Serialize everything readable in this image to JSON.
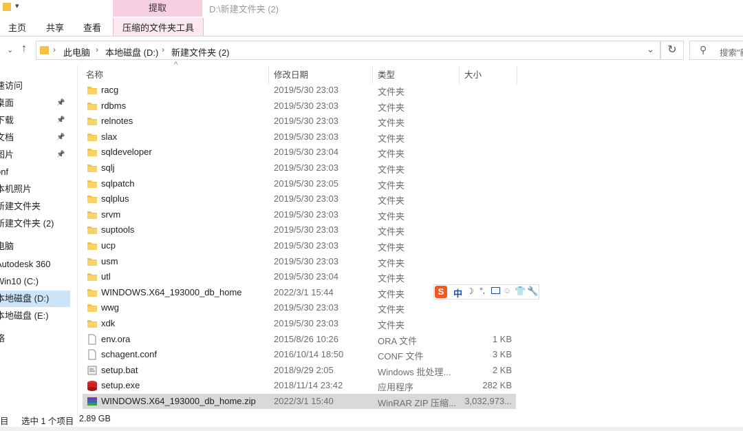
{
  "window": {
    "title": "D:\\新建文件夹 (2)",
    "context_tab": "提取"
  },
  "ribbon": {
    "tabs": [
      "主页",
      "共享",
      "查看"
    ],
    "context_subtab": "压缩的文件夹工具"
  },
  "address": {
    "crumbs": [
      "此电脑",
      "本地磁盘 (D:)",
      "新建文件夹 (2)"
    ],
    "search_placeholder": "搜索\"新"
  },
  "sidebar": {
    "items": [
      {
        "label": "速访问",
        "pinned": false,
        "selected": false
      },
      {
        "label": "桌面",
        "pinned": true,
        "selected": false
      },
      {
        "label": "下载",
        "pinned": true,
        "selected": false
      },
      {
        "label": "文档",
        "pinned": true,
        "selected": false
      },
      {
        "label": "图片",
        "pinned": true,
        "selected": false
      },
      {
        "label": "onf",
        "pinned": false,
        "selected": false
      },
      {
        "label": "本机照片",
        "pinned": false,
        "selected": false
      },
      {
        "label": "新建文件夹",
        "pinned": false,
        "selected": false
      },
      {
        "label": "新建文件夹 (2)",
        "pinned": false,
        "selected": false
      },
      {
        "label": "电脑",
        "pinned": false,
        "selected": false
      },
      {
        "label": "Autodesk 360",
        "pinned": false,
        "selected": false
      },
      {
        "label": "Win10 (C:)",
        "pinned": false,
        "selected": false
      },
      {
        "label": "本地磁盘 (D:)",
        "pinned": false,
        "selected": true
      },
      {
        "label": "本地磁盘 (E:)",
        "pinned": false,
        "selected": false
      },
      {
        "label": "络",
        "pinned": false,
        "selected": false
      }
    ]
  },
  "columns": {
    "name": "名称",
    "date": "修改日期",
    "type": "类型",
    "size": "大小"
  },
  "files": [
    {
      "name": "racg",
      "date": "2019/5/30 23:03",
      "type": "文件夹",
      "size": "",
      "icon": "folder"
    },
    {
      "name": "rdbms",
      "date": "2019/5/30 23:03",
      "type": "文件夹",
      "size": "",
      "icon": "folder"
    },
    {
      "name": "relnotes",
      "date": "2019/5/30 23:03",
      "type": "文件夹",
      "size": "",
      "icon": "folder"
    },
    {
      "name": "slax",
      "date": "2019/5/30 23:03",
      "type": "文件夹",
      "size": "",
      "icon": "folder"
    },
    {
      "name": "sqldeveloper",
      "date": "2019/5/30 23:04",
      "type": "文件夹",
      "size": "",
      "icon": "folder"
    },
    {
      "name": "sqlj",
      "date": "2019/5/30 23:03",
      "type": "文件夹",
      "size": "",
      "icon": "folder"
    },
    {
      "name": "sqlpatch",
      "date": "2019/5/30 23:05",
      "type": "文件夹",
      "size": "",
      "icon": "folder"
    },
    {
      "name": "sqlplus",
      "date": "2019/5/30 23:03",
      "type": "文件夹",
      "size": "",
      "icon": "folder"
    },
    {
      "name": "srvm",
      "date": "2019/5/30 23:03",
      "type": "文件夹",
      "size": "",
      "icon": "folder"
    },
    {
      "name": "suptools",
      "date": "2019/5/30 23:03",
      "type": "文件夹",
      "size": "",
      "icon": "folder"
    },
    {
      "name": "ucp",
      "date": "2019/5/30 23:03",
      "type": "文件夹",
      "size": "",
      "icon": "folder"
    },
    {
      "name": "usm",
      "date": "2019/5/30 23:03",
      "type": "文件夹",
      "size": "",
      "icon": "folder"
    },
    {
      "name": "utl",
      "date": "2019/5/30 23:04",
      "type": "文件夹",
      "size": "",
      "icon": "folder"
    },
    {
      "name": "WINDOWS.X64_193000_db_home",
      "date": "2022/3/1 15:44",
      "type": "文件夹",
      "size": "",
      "icon": "folder"
    },
    {
      "name": "wwg",
      "date": "2019/5/30 23:03",
      "type": "文件夹",
      "size": "",
      "icon": "folder"
    },
    {
      "name": "xdk",
      "date": "2019/5/30 23:03",
      "type": "文件夹",
      "size": "",
      "icon": "folder"
    },
    {
      "name": "env.ora",
      "date": "2015/8/26 10:26",
      "type": "ORA 文件",
      "size": "1 KB",
      "icon": "file"
    },
    {
      "name": "schagent.conf",
      "date": "2016/10/14 18:50",
      "type": "CONF 文件",
      "size": "3 KB",
      "icon": "file"
    },
    {
      "name": "setup.bat",
      "date": "2018/9/29 2:05",
      "type": "Windows 批处理...",
      "size": "2 KB",
      "icon": "bat"
    },
    {
      "name": "setup.exe",
      "date": "2018/11/14 23:42",
      "type": "应用程序",
      "size": "282 KB",
      "icon": "exe"
    },
    {
      "name": "WINDOWS.X64_193000_db_home.zip",
      "date": "2022/3/1 15:40",
      "type": "WinRAR ZIP 压缩...",
      "size": "3,032,973...",
      "icon": "rar"
    }
  ],
  "selected_index": 20,
  "status": {
    "count": "目",
    "selection": "选中 1 个项目",
    "size": "2.89 GB"
  },
  "ime": {
    "label": "中"
  }
}
